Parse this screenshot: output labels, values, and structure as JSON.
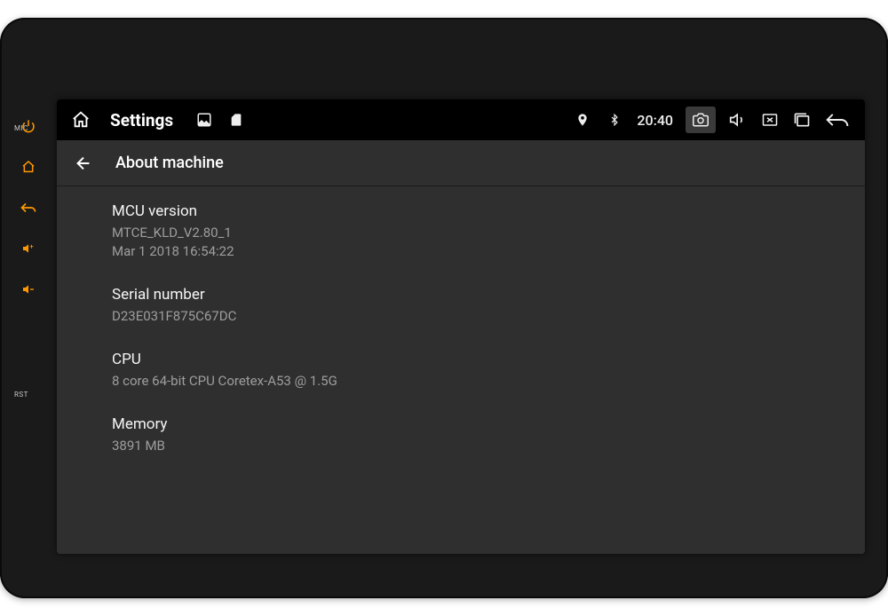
{
  "sidePanel": {
    "micLabel": "MIC",
    "rstLabel": "RST"
  },
  "statusbar": {
    "title": "Settings",
    "time": "20:40"
  },
  "subheader": {
    "title": "About machine"
  },
  "settings": {
    "mcu": {
      "label": "MCU version",
      "value": "MTCE_KLD_V2.80_1\nMar  1 2018 16:54:22"
    },
    "serial": {
      "label": "Serial number",
      "value": "D23E031F875C67DC"
    },
    "cpu": {
      "label": "CPU",
      "value": "8 core 64-bit CPU Coretex-A53 @ 1.5G"
    },
    "memory": {
      "label": "Memory",
      "value": "3891 MB"
    }
  }
}
